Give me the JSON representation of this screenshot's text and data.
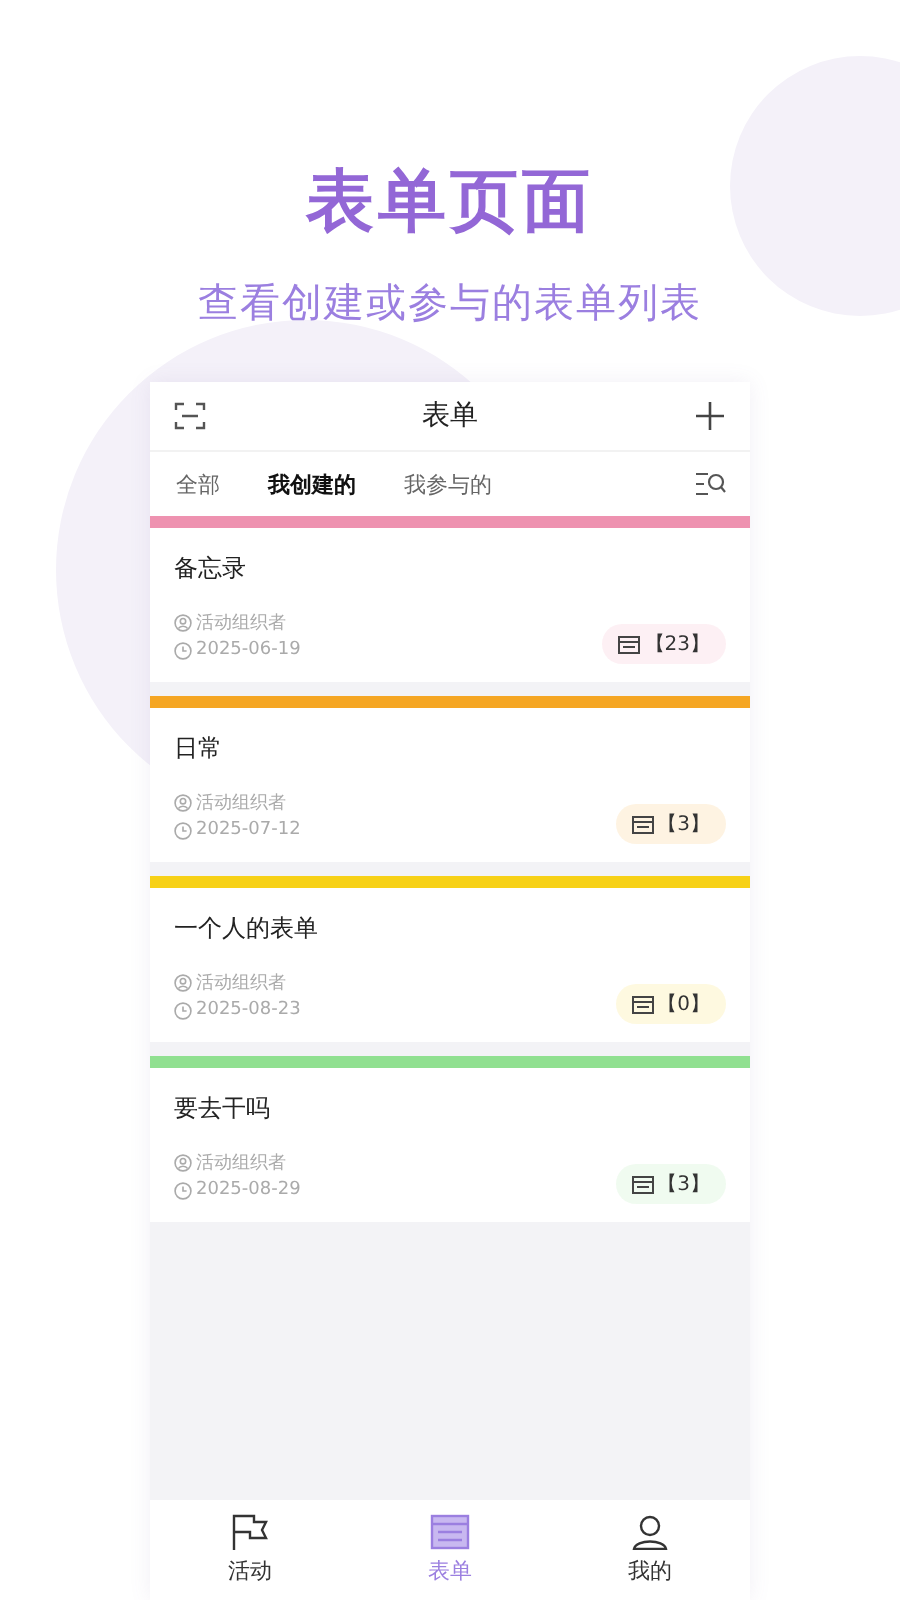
{
  "promo": {
    "title": "表单页面",
    "subtitle": "查看创建或参与的表单列表"
  },
  "header": {
    "title": "表单"
  },
  "tabs": [
    {
      "label": "全部",
      "selected": false
    },
    {
      "label": "我创建的",
      "selected": true
    },
    {
      "label": "我参与的",
      "selected": false
    }
  ],
  "forms": [
    {
      "title": "备忘录",
      "organizer": "活动组织者",
      "date": "2025-06-19",
      "count": "【23】",
      "color": "#ee92b0"
    },
    {
      "title": "日常",
      "organizer": "活动组织者",
      "date": "2025-07-12",
      "count": "【3】",
      "color": "#f5a623"
    },
    {
      "title": "一个人的表单",
      "organizer": "活动组织者",
      "date": "2025-08-23",
      "count": "【0】",
      "color": "#f7d117"
    },
    {
      "title": "要去干吗",
      "organizer": "活动组织者",
      "date": "2025-08-29",
      "count": "【3】",
      "color": "#90e090"
    }
  ],
  "nav": [
    {
      "label": "活动",
      "kind": "flag",
      "selected": false
    },
    {
      "label": "表单",
      "kind": "form",
      "selected": true
    },
    {
      "label": "我的",
      "kind": "person",
      "selected": false
    }
  ]
}
